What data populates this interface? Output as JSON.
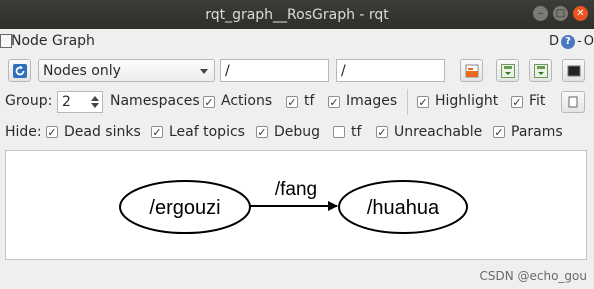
{
  "window": {
    "title": "rqt_graph__RosGraph - rqt",
    "minimize_glyph": "–",
    "maximize_glyph": "□",
    "close_glyph": "✕"
  },
  "plugin": {
    "title": "Node Graph",
    "right_letter": "D",
    "help_glyph": "?",
    "dash": "-",
    "close_letter": "O"
  },
  "toolbar": {
    "refresh_icon": "refresh-icon",
    "mode_selected": "Nodes only",
    "filter_1": "/",
    "filter_2": "/",
    "load_icon": "folder-open-icon",
    "save_dot_icon": "save-dot-icon",
    "save_svg_icon": "save-svg-icon",
    "screenshot_icon": "screenshot-icon"
  },
  "options": {
    "group_label": "Group:",
    "group_value": "2",
    "namespaces_label": "Namespaces",
    "actions_label": "Actions",
    "tf_label": "tf",
    "images_label": "Images",
    "highlight_label": "Highlight",
    "fit_label": "Fit",
    "actions_checked": true,
    "tf_checked": true,
    "images_checked": true,
    "highlight_checked": true,
    "fit_checked": true
  },
  "hide": {
    "label": "Hide:",
    "items": [
      {
        "label": "Dead sinks",
        "checked": true
      },
      {
        "label": "Leaf topics",
        "checked": true
      },
      {
        "label": "Debug",
        "checked": true
      },
      {
        "label": "tf",
        "checked": false
      },
      {
        "label": "Unreachable",
        "checked": true
      },
      {
        "label": "Params",
        "checked": true
      }
    ]
  },
  "graph": {
    "nodes": [
      {
        "name": "/ergouzi"
      },
      {
        "name": "/huahua"
      }
    ],
    "edges": [
      {
        "from": "/ergouzi",
        "to": "/huahua",
        "topic": "/fang"
      }
    ]
  },
  "watermark": "CSDN @echo_gou",
  "colors": {
    "titlebar": "#2f2e2b",
    "close_button": "#e95420",
    "help_icon": "#4a78c2",
    "canvas": "#ffffff"
  }
}
